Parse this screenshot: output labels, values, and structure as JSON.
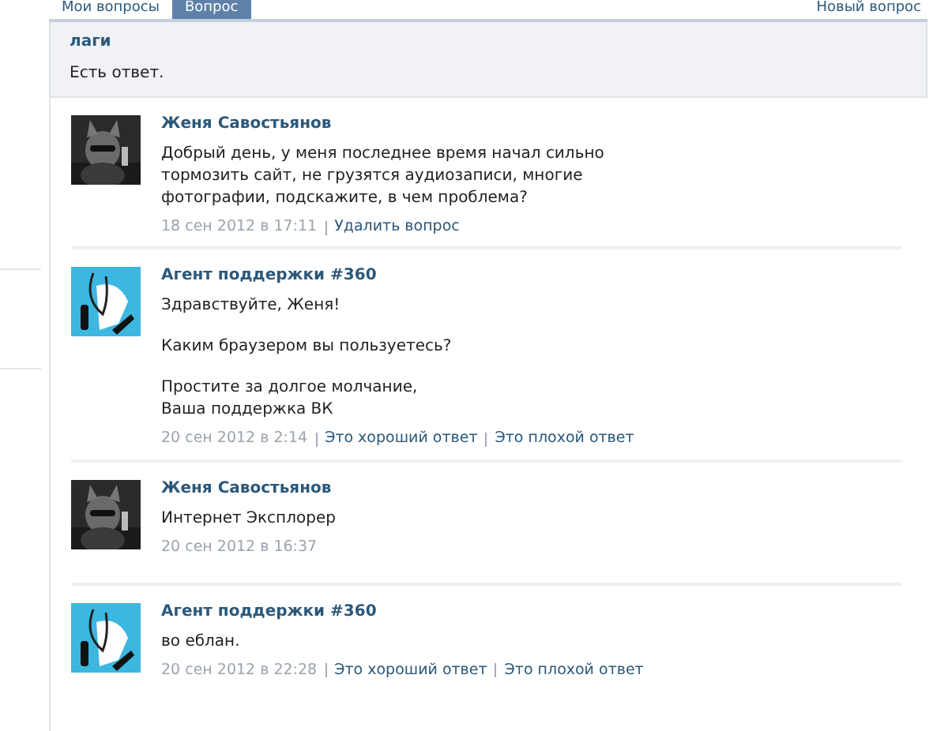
{
  "tabs": [
    {
      "label": "Мои вопросы",
      "selected": false
    },
    {
      "label": "Вопрос",
      "selected": true
    }
  ],
  "new_question_link": "Новый вопрос",
  "question": {
    "title": "лаги",
    "status": "Есть ответ."
  },
  "messages": [
    {
      "kind": "user",
      "author": "Женя Савостьянов",
      "paragraphs": [
        "Добрый день, у меня последнее время начал сильно тормозить сайт, не грузятся аудиозаписи, многие фотографии, подскажите, в чем проблема?"
      ],
      "date": "18 сен 2012 в 17:11",
      "actions": [
        "Удалить вопрос"
      ]
    },
    {
      "kind": "agent",
      "author": "Агент поддержки #360",
      "paragraphs": [
        "Здравствуйте, Женя!",
        "Каким браузером вы пользуетесь?",
        "Простите за долгое молчание,\nВаша поддержка ВК"
      ],
      "date": "20 сен 2012 в 2:14",
      "actions": [
        "Это хороший ответ",
        "Это плохой ответ"
      ]
    },
    {
      "kind": "user",
      "author": "Женя Савостьянов",
      "paragraphs": [
        "Интернет Эксплорер"
      ],
      "date": "20 сен 2012 в 16:37"
    },
    {
      "kind": "agent",
      "author": "Агент поддержки #360",
      "paragraphs": [
        "во еблан."
      ],
      "date": "20 сен 2012 в 22:28",
      "actions": [
        "Это хороший ответ",
        "Это плохой ответ"
      ]
    }
  ]
}
